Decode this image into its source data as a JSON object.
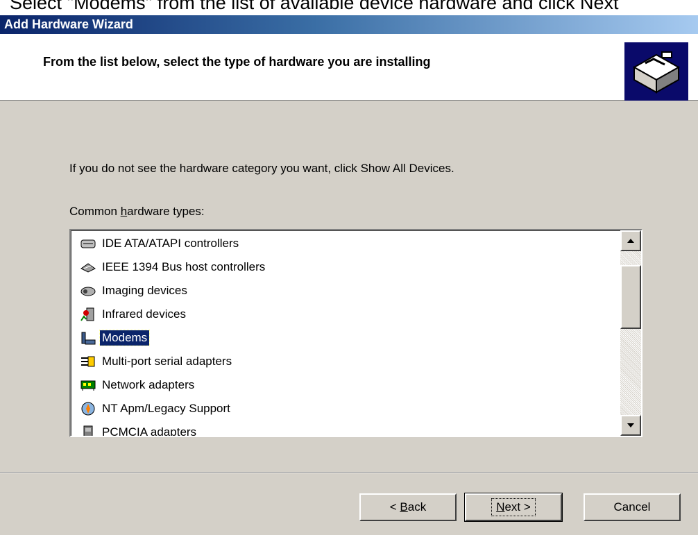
{
  "caption": "Select \"Modems\" from the list of available device hardware and click Next",
  "window": {
    "title": "Add Hardware Wizard"
  },
  "header": {
    "heading": "From the list below, select the type of hardware you are installing",
    "icon": "hardware-wizard-icon"
  },
  "info_text": "If you do not see the hardware category you want, click Show All Devices.",
  "list": {
    "label_prefix": "Common ",
    "label_accel": "h",
    "label_suffix": "ardware types:",
    "items": [
      {
        "label": "IDE ATA/ATAPI controllers",
        "icon": "ide-controller-icon"
      },
      {
        "label": "IEEE 1394 Bus host controllers",
        "icon": "firewire-controller-icon"
      },
      {
        "label": "Imaging devices",
        "icon": "camera-icon"
      },
      {
        "label": "Infrared devices",
        "icon": "infrared-icon"
      },
      {
        "label": "Modems",
        "icon": "modem-icon",
        "selected": true
      },
      {
        "label": "Multi-port serial adapters",
        "icon": "serial-adapter-icon"
      },
      {
        "label": "Network adapters",
        "icon": "network-adapter-icon"
      },
      {
        "label": "NT Apm/Legacy Support",
        "icon": "apm-icon"
      },
      {
        "label": "PCMCIA adapters",
        "icon": "pcmcia-icon"
      }
    ]
  },
  "buttons": {
    "back_prefix": "< ",
    "back_accel": "B",
    "back_suffix": "ack",
    "next_accel": "N",
    "next_suffix": "ext >",
    "cancel": "Cancel"
  },
  "colors": {
    "selection": "#0a246a",
    "face": "#d4d0c8",
    "title_start": "#0a246a",
    "title_end": "#a6caf0"
  }
}
